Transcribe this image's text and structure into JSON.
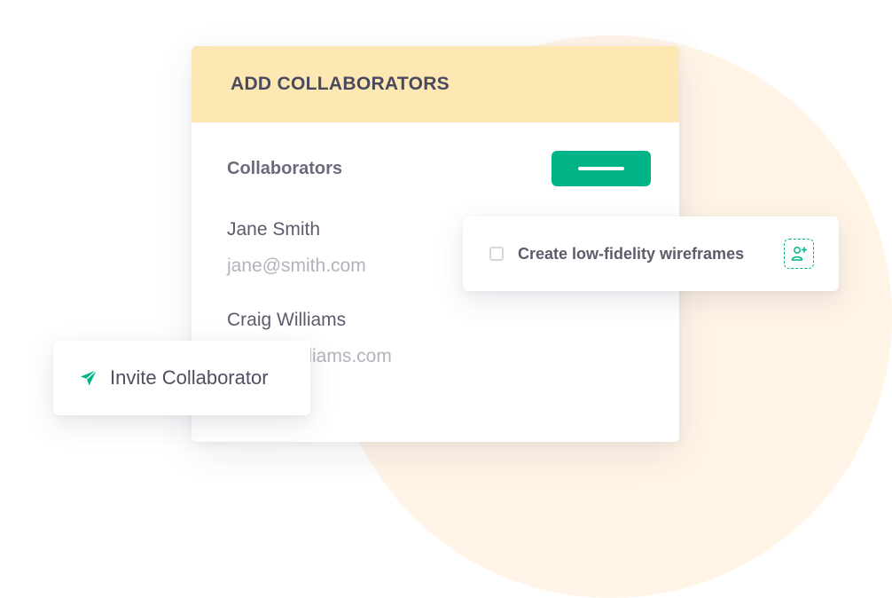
{
  "header": {
    "title": "ADD COLLABORATORS"
  },
  "section": {
    "label": "Collaborators",
    "remove_button_icon": "minus-icon"
  },
  "collaborators": [
    {
      "name": "Jane Smith",
      "email": "jane@smith.com"
    },
    {
      "name": "Craig Williams",
      "email": "craig@williams.com"
    }
  ],
  "task": {
    "label": "Create low-fidelity wireframes",
    "checked": false,
    "assign_icon": "add-user-icon"
  },
  "invite": {
    "label": "Invite Collaborator",
    "icon": "send-icon"
  },
  "colors": {
    "accent": "#00b488",
    "header_bg": "#fde8b3",
    "backdrop": "#fff4e6",
    "text_primary": "#5c5c6c",
    "text_muted": "#b3b3bd"
  }
}
